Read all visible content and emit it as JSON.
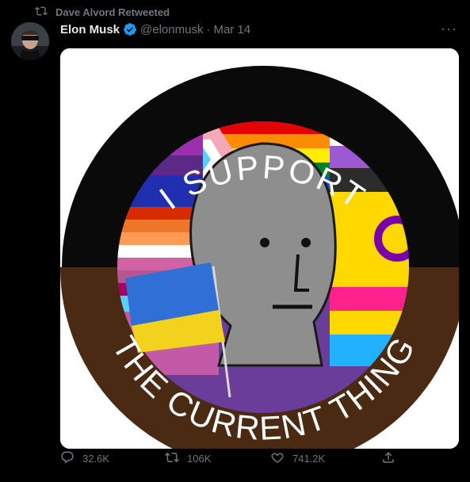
{
  "retweet": {
    "label": "Dave Alvord Retweeted",
    "icon": "retweet-icon"
  },
  "author": {
    "name": "Elon Musk",
    "handle": "@elonmusk",
    "separator": "·",
    "date": "Mar 14",
    "verified_icon": "verified-badge-icon"
  },
  "more_label": "···",
  "image": {
    "top_text": "I SUPPORT",
    "bottom_text": "THE CURRENT THING"
  },
  "actions": {
    "replies": "32.6K",
    "retweets": "106K",
    "likes": "741.2K"
  },
  "colors": {
    "background": "#000000",
    "muted": "#71767b",
    "verified": "#1d9bf0",
    "badge_black": "#0a0a0a",
    "badge_brown": "#4a2a12",
    "npc_gray": "#8e8e8e"
  }
}
